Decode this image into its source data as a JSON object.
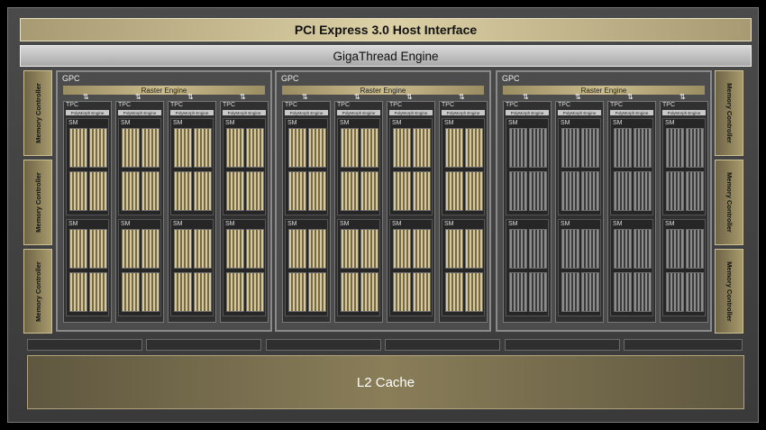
{
  "pcie_label": "PCI Express 3.0 Host Interface",
  "gigathread_label": "GigaThread Engine",
  "l2_label": "L2 Cache",
  "memory_controller_label": "Memory Controller",
  "gpc_label": "GPC",
  "raster_engine_label": "Raster Engine",
  "tpc_label": "TPC",
  "polymorph_engine_label": "PolyMorph Engine",
  "sm_label": "SM",
  "arrow_glyph": "⇅",
  "colors": {
    "gold": "#d8c99b",
    "silver": "#8d8d8d",
    "frame": "#4a4a4a"
  },
  "gpcs": [
    {
      "label": "GPC",
      "core_style": "gold"
    },
    {
      "label": "GPC",
      "core_style": "gold"
    },
    {
      "label": "GPC",
      "core_style": "silver"
    }
  ]
}
